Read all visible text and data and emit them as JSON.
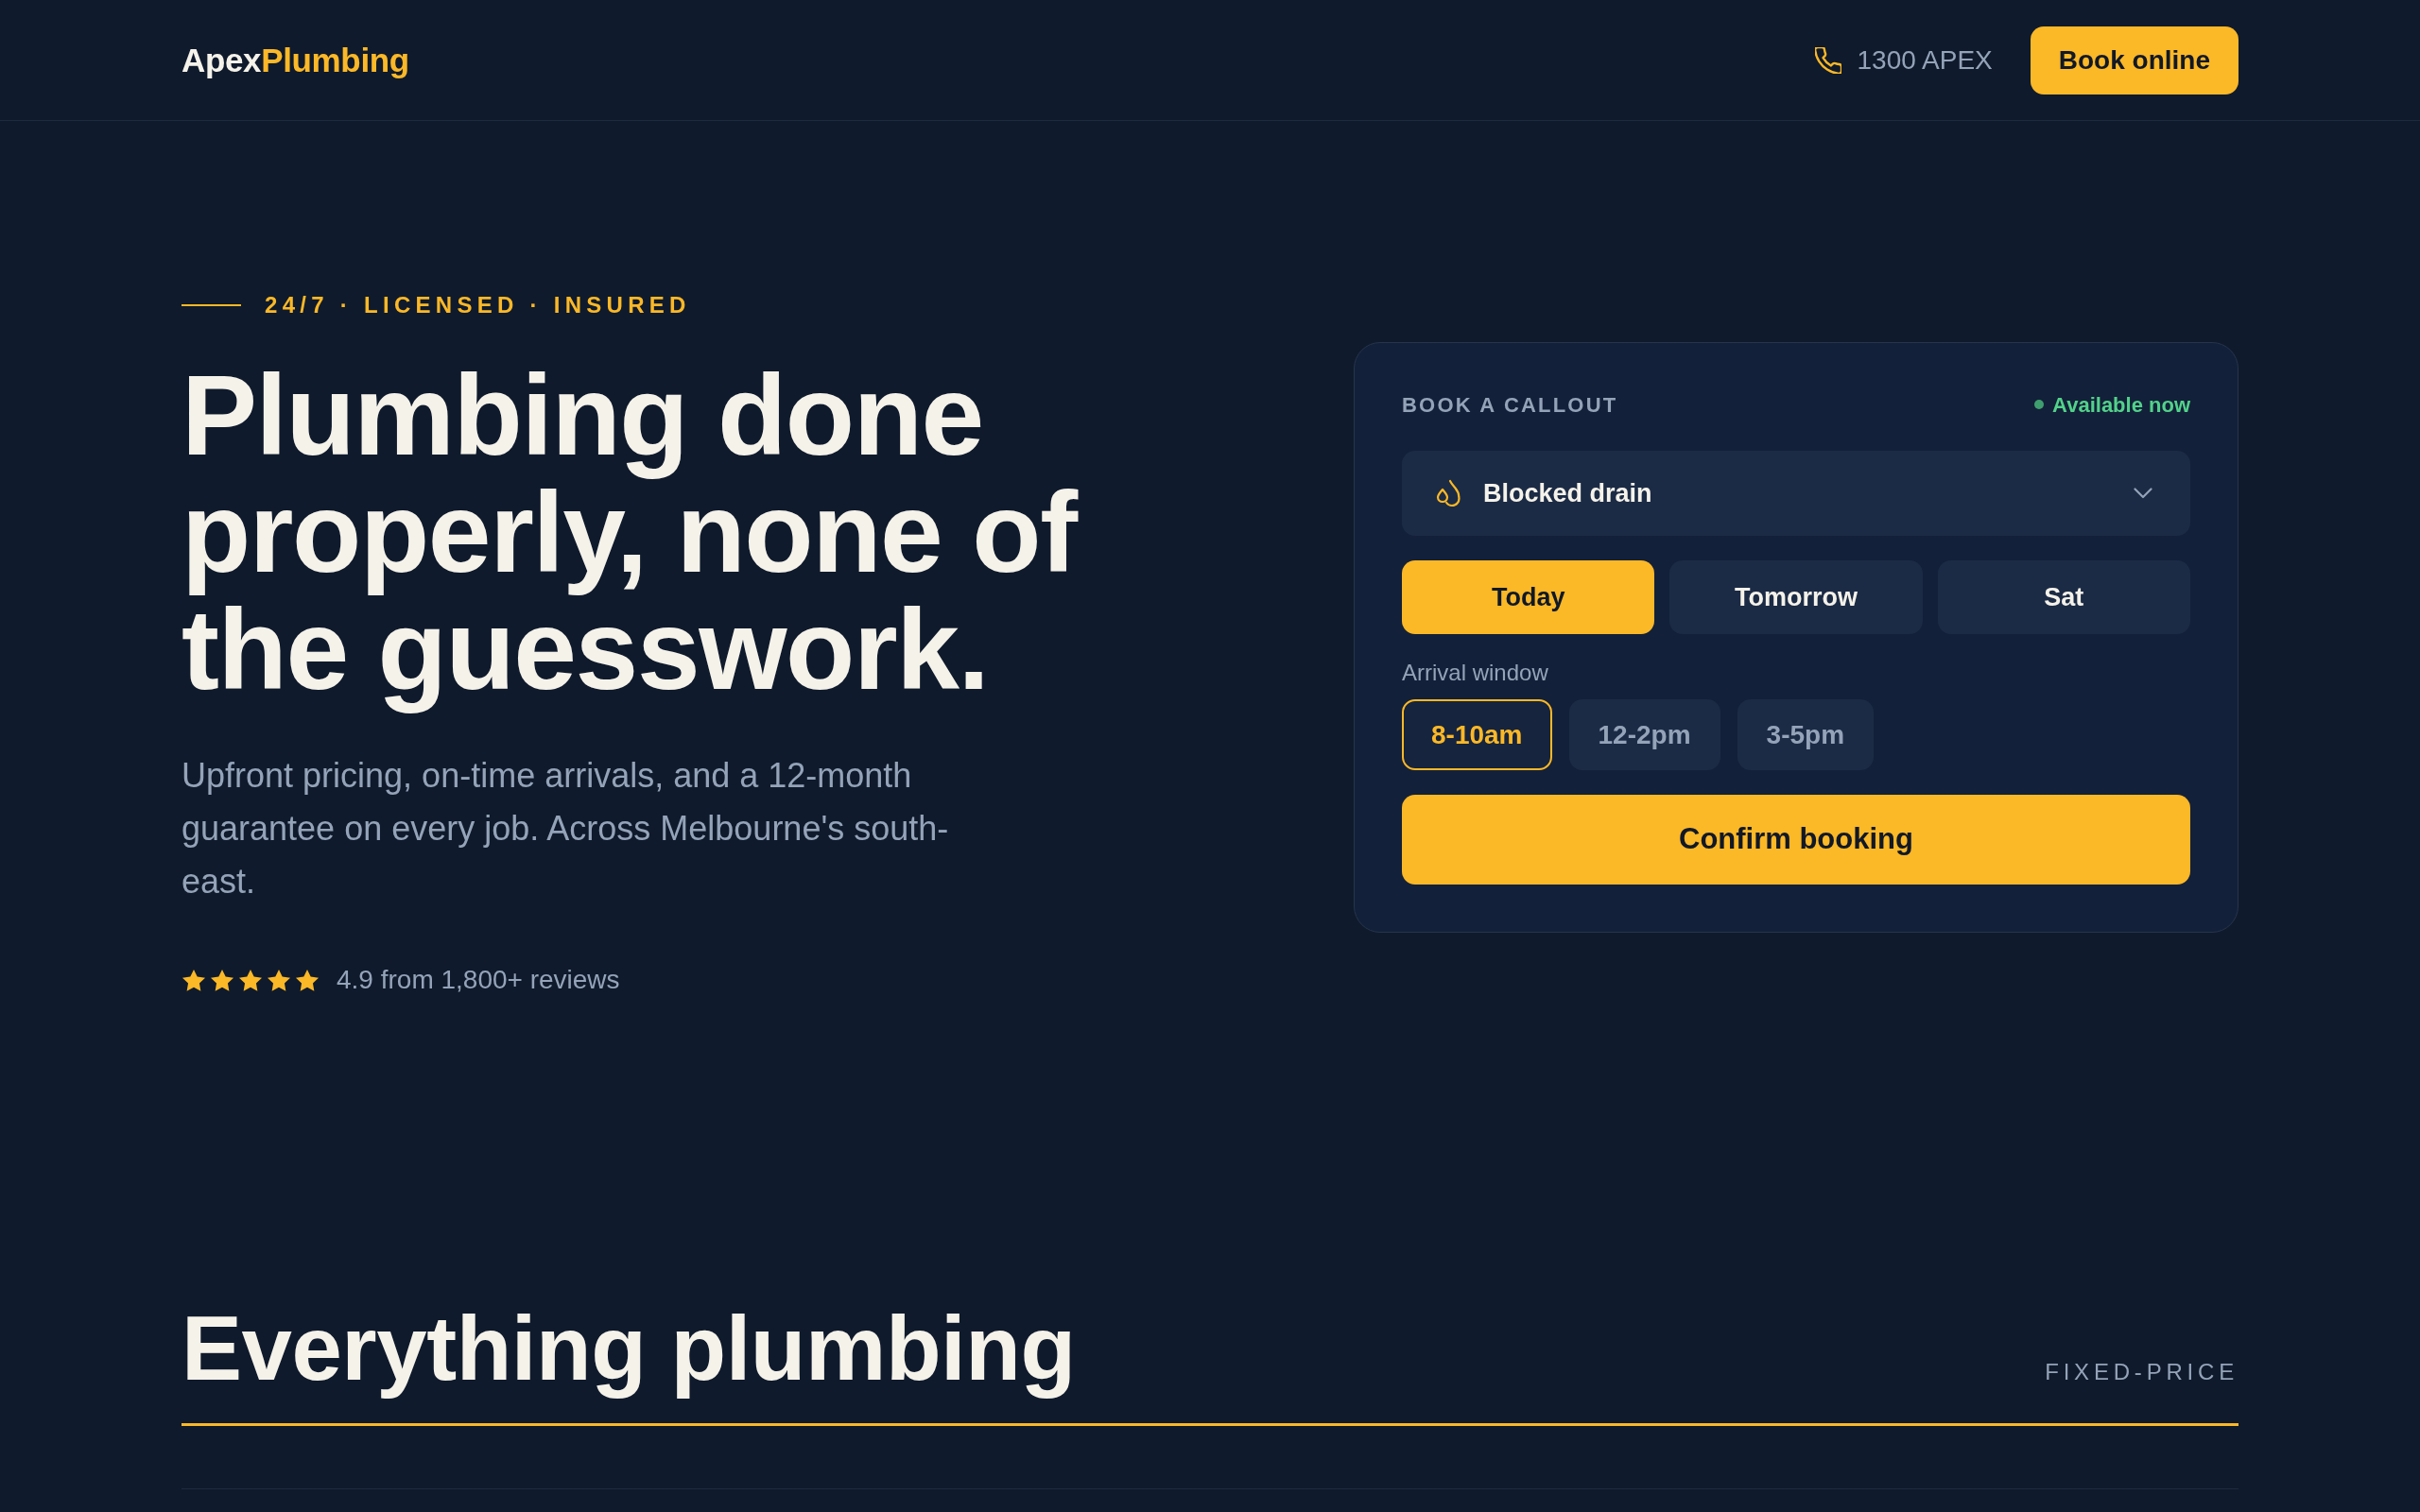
{
  "header": {
    "logo": {
      "primary": "Apex",
      "accent": "Plumbing"
    },
    "phone": "1300 APEX",
    "cta": "Book online"
  },
  "hero": {
    "eyebrow": "24/7 · LICENSED · INSURED",
    "headline": "Plumbing done properly, none of the guesswork.",
    "description": "Upfront pricing, on-time arrivals, and a 12-month guarantee on every job. Across Melbourne's south-east.",
    "rating": {
      "stars": 5,
      "text": "4.9 from 1,800+ reviews"
    }
  },
  "booking_card": {
    "title": "BOOK A CALLOUT",
    "availability": "Available now",
    "service_select": {
      "value": "Blocked drain"
    },
    "days": [
      {
        "label": "Today",
        "selected": true
      },
      {
        "label": "Tomorrow",
        "selected": false
      },
      {
        "label": "Sat",
        "selected": false
      }
    ],
    "arrival_label": "Arrival window",
    "arrival_windows": [
      {
        "label": "8-10am",
        "selected": true
      },
      {
        "label": "12-2pm",
        "selected": false
      },
      {
        "label": "3-5pm",
        "selected": false
      }
    ],
    "confirm": "Confirm booking"
  },
  "services_section": {
    "title": "Everything plumbing",
    "tag": "FIXED-PRICE"
  }
}
